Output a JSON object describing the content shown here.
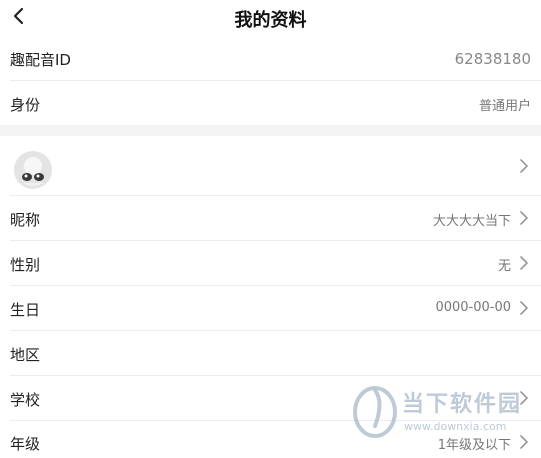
{
  "header": {
    "title": "我的资料"
  },
  "rows": {
    "qupeiyin_id": {
      "label": "趣配音ID",
      "value": "62838180"
    },
    "identity": {
      "label": "身份",
      "value": "普通用户"
    },
    "nickname": {
      "label": "昵称",
      "value": "大大大大当下"
    },
    "gender": {
      "label": "性别",
      "value": "无"
    },
    "birthday": {
      "label": "生日",
      "value": "0000-00-00"
    },
    "region": {
      "label": "地区",
      "value": ""
    },
    "school": {
      "label": "学校",
      "value": ""
    },
    "grade": {
      "label": "年级",
      "value": "1年级及以下"
    }
  },
  "watermark": {
    "brand": "当下软件园",
    "url": "www.downxia.com"
  },
  "icons": {
    "back": "chevron-left-icon",
    "arrow": "chevron-right-icon",
    "avatar": "avatar-placeholder"
  }
}
